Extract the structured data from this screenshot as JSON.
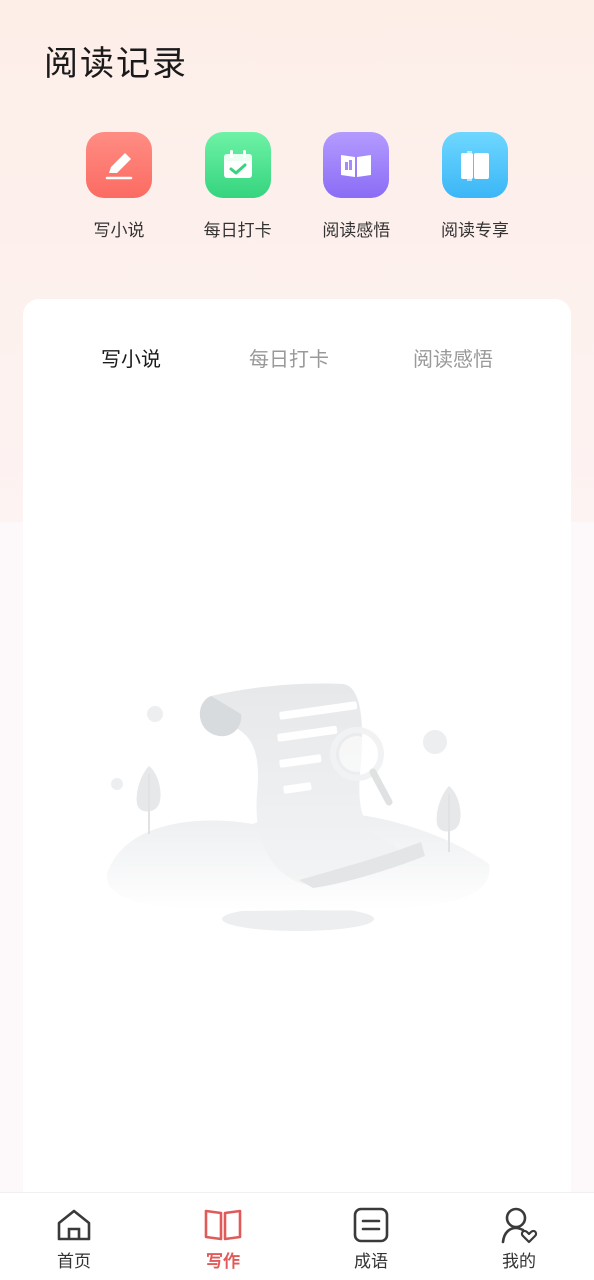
{
  "header": {
    "title": "阅读记录"
  },
  "shortcuts": [
    {
      "label": "写小说",
      "icon": "pencil-icon",
      "color": "#fb6b63"
    },
    {
      "label": "每日打卡",
      "icon": "calendar-check-icon",
      "color": "#35d47f"
    },
    {
      "label": "阅读感悟",
      "icon": "open-book-icon",
      "color": "#8a6cf5"
    },
    {
      "label": "阅读专享",
      "icon": "book-pages-icon",
      "color": "#3bb6f6"
    }
  ],
  "tabs": [
    {
      "label": "写小说",
      "active": true
    },
    {
      "label": "每日打卡",
      "active": false
    },
    {
      "label": "阅读感悟",
      "active": false
    }
  ],
  "empty_state": {
    "illustration": "empty-scroll-magnifier-illustration"
  },
  "bottom_nav": [
    {
      "label": "首页",
      "icon": "home-icon",
      "active": false
    },
    {
      "label": "写作",
      "icon": "book-icon",
      "active": true
    },
    {
      "label": "成语",
      "icon": "list-box-icon",
      "active": false
    },
    {
      "label": "我的",
      "icon": "user-heart-icon",
      "active": false
    }
  ],
  "colors": {
    "accent": "#e05a5a",
    "inactive_tab": "#999999"
  }
}
